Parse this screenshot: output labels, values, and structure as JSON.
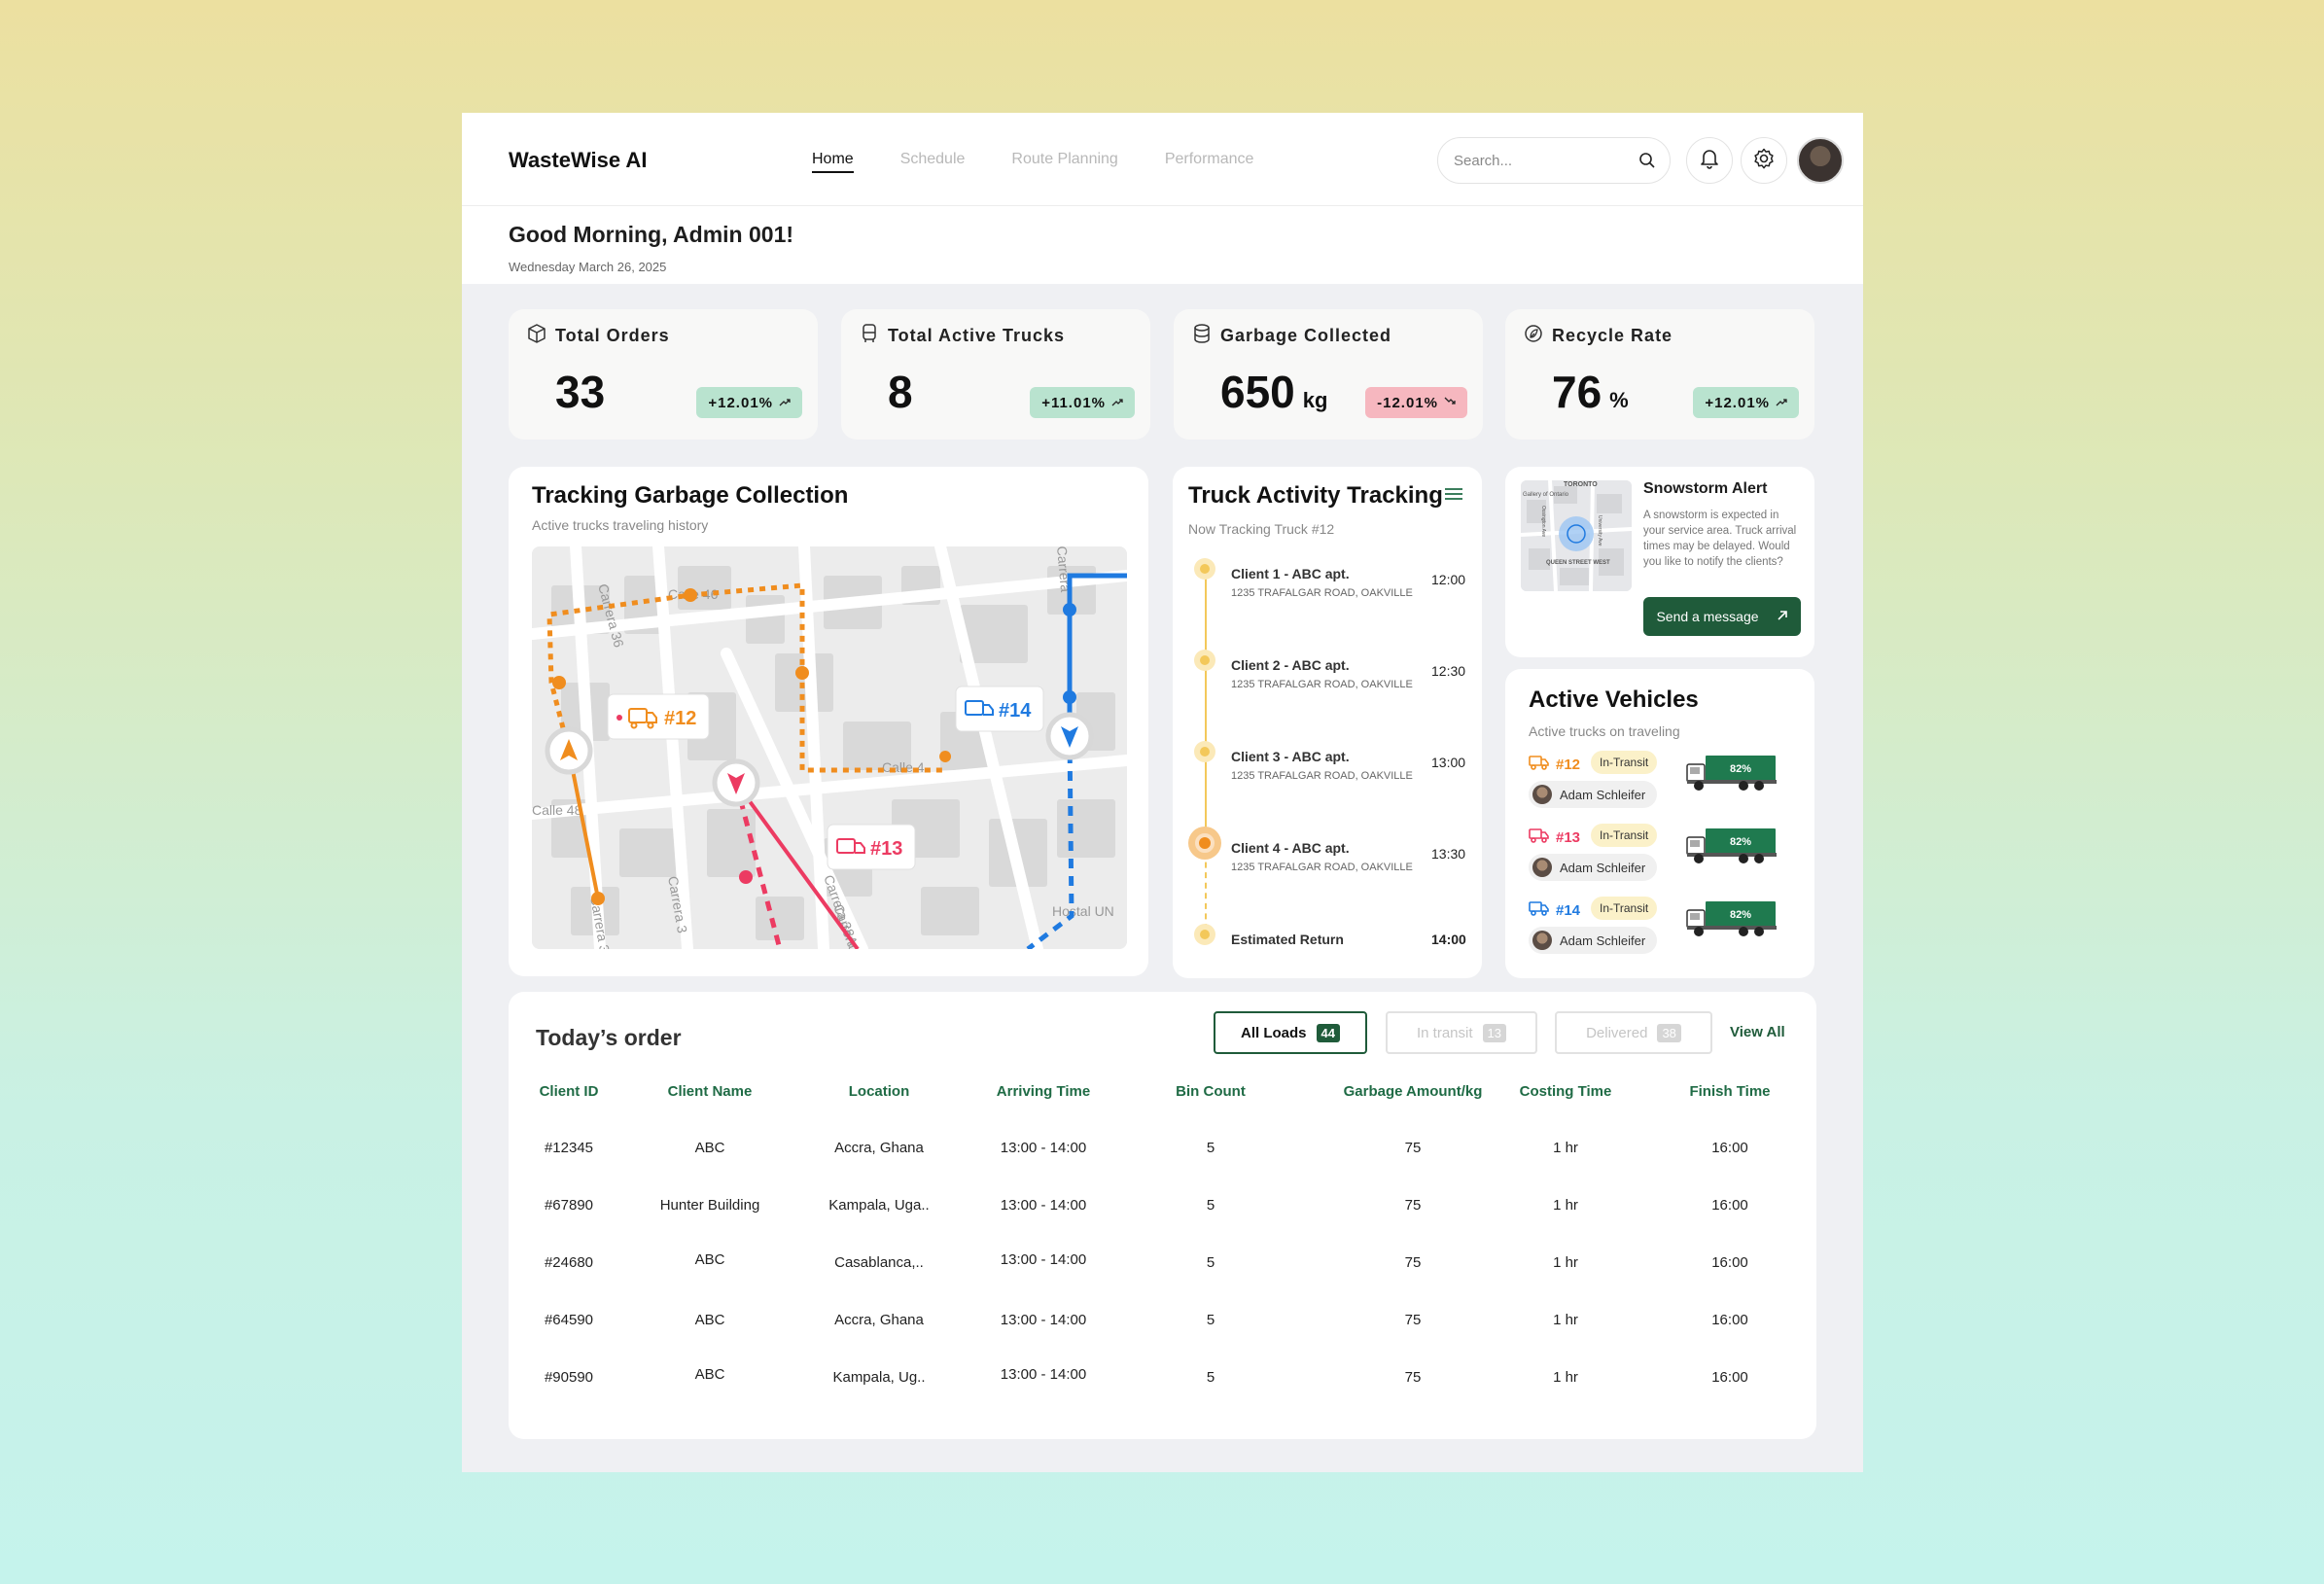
{
  "app": {
    "brand": "WasteWise AI"
  },
  "nav": {
    "items": [
      "Home",
      "Schedule",
      "Route Planning",
      "Performance"
    ],
    "active": "Home"
  },
  "search": {
    "placeholder": "Search..."
  },
  "header": {
    "greeting": "Good Morning, Admin 001!",
    "date": "Wednesday March 26, 2025"
  },
  "kpis": [
    {
      "title": "Total Orders",
      "value": "33",
      "unit": "",
      "change": "+12.01%",
      "trend": "up",
      "icon": "box-icon"
    },
    {
      "title": "Total Active Trucks",
      "value": "8",
      "unit": "",
      "change": "+11.01%",
      "trend": "up",
      "icon": "bus-icon"
    },
    {
      "title": "Garbage Collected",
      "value": "650",
      "unit": "kg",
      "change": "-12.01%",
      "trend": "down",
      "icon": "database-icon"
    },
    {
      "title": "Recycle Rate",
      "value": "76",
      "unit": "%",
      "change": "+12.01%",
      "trend": "up",
      "icon": "leaf-icon"
    }
  ],
  "map": {
    "title": "Tracking Garbage Collection",
    "subtitle": "Active trucks traveling history",
    "trucks": [
      "#12",
      "#13",
      "#14"
    ],
    "street_labels": [
      "Carrera 36",
      "Calle 46",
      "Calle 4",
      "Calle 48",
      "Carrera 3",
      "Carrera 38A",
      "Carrera 3",
      "Carrera",
      "Hostal UN",
      "Carrera 3"
    ],
    "colors": {
      "t12": "#f08d1e",
      "t13": "#ec3b62",
      "t14": "#1f7ae0"
    }
  },
  "activity": {
    "title": "Truck Activity Tracking",
    "subtitle": "Now Tracking Truck #12",
    "items": [
      {
        "name": "Client 1 - ABC apt.",
        "address": "1235 TRAFALGAR ROAD, OAKVILLE",
        "time": "12:00"
      },
      {
        "name": "Client 2 - ABC apt.",
        "address": "1235 TRAFALGAR ROAD, OAKVILLE",
        "time": "12:30"
      },
      {
        "name": "Client 3 - ABC apt.",
        "address": "1235 TRAFALGAR ROAD, OAKVILLE",
        "time": "13:00"
      },
      {
        "name": "Client 4 - ABC apt.",
        "address": "1235 TRAFALGAR ROAD, OAKVILLE",
        "time": "13:30"
      }
    ],
    "return_label": "Estimated Return",
    "return_time": "14:00"
  },
  "alert": {
    "title": "Snowstorm Alert",
    "text": "A snowstorm is expected in your service area. Truck arrival times may be delayed. Would you like to notify the clients?",
    "button": "Send a message",
    "map_labels": [
      "TORONTO",
      "Gallery of Ontario",
      "QUEEN STREET WEST",
      "Ossington Ave",
      "University Ave"
    ]
  },
  "vehicles": {
    "title": "Active Vehicles",
    "subtitle": "Active trucks on traveling",
    "items": [
      {
        "id": "#12",
        "status": "In-Transit",
        "driver": "Adam Schleifer",
        "load": "82%",
        "color": "#f08d1e"
      },
      {
        "id": "#13",
        "status": "In-Transit",
        "driver": "Adam Schleifer",
        "load": "82%",
        "color": "#ec3b62"
      },
      {
        "id": "#14",
        "status": "In-Transit",
        "driver": "Adam Schleifer",
        "load": "82%",
        "color": "#1f7ae0"
      }
    ]
  },
  "orders": {
    "title": "Today’s order",
    "tabs": [
      {
        "label": "All Loads",
        "count": "44"
      },
      {
        "label": "In transit",
        "count": "13"
      },
      {
        "label": "Delivered",
        "count": "38"
      }
    ],
    "view_all": "View All",
    "columns": [
      "Client ID",
      "Client Name",
      "Location",
      "Arriving Time",
      "Bin Count",
      "Garbage Amount/kg",
      "Costing Time",
      "Finish Time"
    ],
    "rows": [
      [
        "#12345",
        "ABC",
        "Accra, Ghana",
        "13:00 - 14:00",
        "5",
        "75",
        "1 hr",
        "16:00"
      ],
      [
        "#67890",
        "Hunter Building",
        "Kampala, Uga..",
        "13:00 - 14:00",
        "5",
        "75",
        "1 hr",
        "16:00"
      ],
      [
        "#24680",
        "ABC",
        "Casablanca,..",
        "13:00 - 14:00",
        "5",
        "75",
        "1 hr",
        "16:00"
      ],
      [
        "#64590",
        "ABC",
        "Accra, Ghana",
        "13:00 - 14:00",
        "5",
        "75",
        "1 hr",
        "16:00"
      ],
      [
        "#90590",
        "ABC",
        "Kampala, Ug..",
        "13:00 - 14:00",
        "5",
        "75",
        "1 hr",
        "16:00"
      ]
    ]
  },
  "theme": {
    "accent": "#1f5b3a",
    "header_green": "#1f6b45",
    "up": "#b9e3cf",
    "down": "#f6b7bf"
  }
}
